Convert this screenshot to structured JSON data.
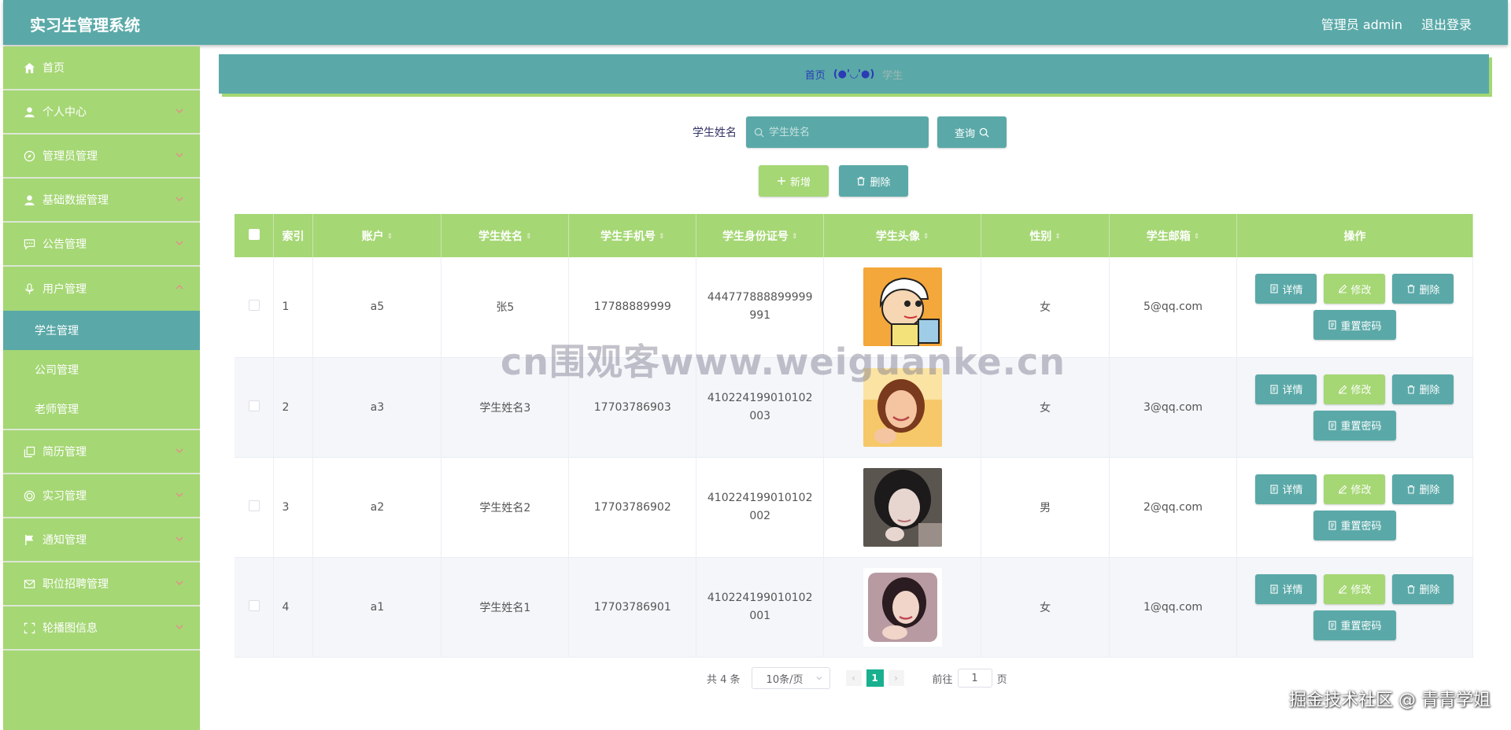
{
  "header": {
    "title": "实习生管理系统",
    "user": "管理员 admin",
    "logout": "退出登录"
  },
  "sidebar": {
    "items": [
      {
        "label": "首页",
        "icon": "home-icon"
      },
      {
        "label": "个人中心",
        "icon": "user-icon"
      },
      {
        "label": "管理员管理",
        "icon": "compass-icon"
      },
      {
        "label": "基础数据管理",
        "icon": "user-icon"
      },
      {
        "label": "公告管理",
        "icon": "chat-icon"
      },
      {
        "label": "用户管理",
        "icon": "mic-icon"
      },
      {
        "label": "简历管理",
        "icon": "copy-icon"
      },
      {
        "label": "实习管理",
        "icon": "target-icon"
      },
      {
        "label": "通知管理",
        "icon": "flag-icon"
      },
      {
        "label": "职位招聘管理",
        "icon": "mail-icon"
      },
      {
        "label": "轮播图信息",
        "icon": "fullscreen-icon"
      }
    ],
    "subitems": [
      "学生管理",
      "公司管理",
      "老师管理"
    ]
  },
  "breadcrumb": {
    "home": "首页",
    "separator": "(●'◡'●)",
    "current": "学生"
  },
  "search": {
    "label": "学生姓名",
    "placeholder": "学生姓名",
    "button": "查询"
  },
  "actions": {
    "add": "新增",
    "delete": "删除"
  },
  "table": {
    "headers": [
      "索引",
      "账户",
      "学生姓名",
      "学生手机号",
      "学生身份证号",
      "学生头像",
      "性别",
      "学生邮箱",
      "操作"
    ],
    "rows": [
      {
        "index": "1",
        "account": "a5",
        "name": "张5",
        "phone": "17788889999",
        "id": "444777888899999991",
        "gender": "女",
        "email": "5@qq.com"
      },
      {
        "index": "2",
        "account": "a3",
        "name": "学生姓名3",
        "phone": "17703786903",
        "id": "410224199010102003",
        "gender": "女",
        "email": "3@qq.com"
      },
      {
        "index": "3",
        "account": "a2",
        "name": "学生姓名2",
        "phone": "17703786902",
        "id": "410224199010102002",
        "gender": "男",
        "email": "2@qq.com"
      },
      {
        "index": "4",
        "account": "a1",
        "name": "学生姓名1",
        "phone": "17703786901",
        "id": "410224199010102001",
        "gender": "女",
        "email": "1@qq.com"
      }
    ],
    "ops": {
      "detail": "详情",
      "edit": "修改",
      "delete": "删除",
      "reset": "重置密码"
    }
  },
  "pager": {
    "total": "共 4 条",
    "size": "10条/页",
    "page": "1",
    "goto_prefix": "前往",
    "goto_value": "1",
    "goto_suffix": "页"
  },
  "watermark": "cn围观客www.weiguanke.cn",
  "credit": "掘金技术社区 @ 青青学姐",
  "colors": {
    "teal": "#5aa9a8",
    "green": "#a5d774",
    "page_active": "#19b08f"
  }
}
